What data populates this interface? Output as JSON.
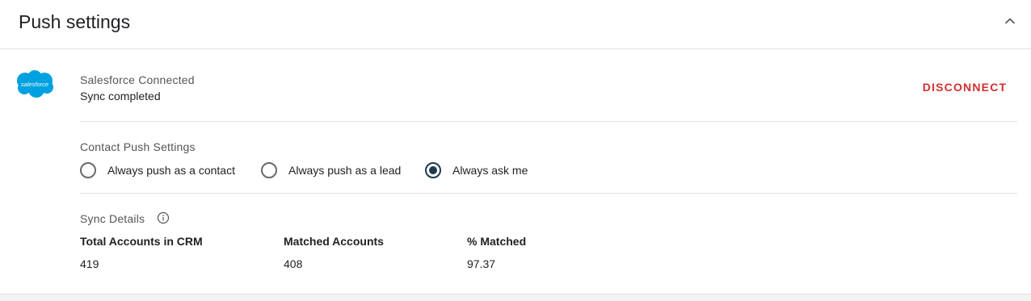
{
  "header": {
    "title": "Push settings",
    "collapse_icon": "chevron-up-icon"
  },
  "connection": {
    "logo_text": "salesforce",
    "logo_color": "#00A1E0",
    "title": "Salesforce Connected",
    "status": "Sync completed",
    "disconnect_label": "DISCONNECT",
    "disconnect_color": "#d32f2f"
  },
  "contact_push": {
    "label": "Contact Push Settings",
    "options": [
      {
        "label": "Always push as a contact",
        "checked": false
      },
      {
        "label": "Always push as a lead",
        "checked": false
      },
      {
        "label": "Always ask me",
        "checked": true
      }
    ]
  },
  "sync_details": {
    "label": "Sync Details",
    "info_icon": "info-icon",
    "columns": [
      {
        "header": "Total Accounts in CRM",
        "value": "419"
      },
      {
        "header": "Matched Accounts",
        "value": "408"
      },
      {
        "header": "% Matched",
        "value": "97.37"
      }
    ]
  }
}
